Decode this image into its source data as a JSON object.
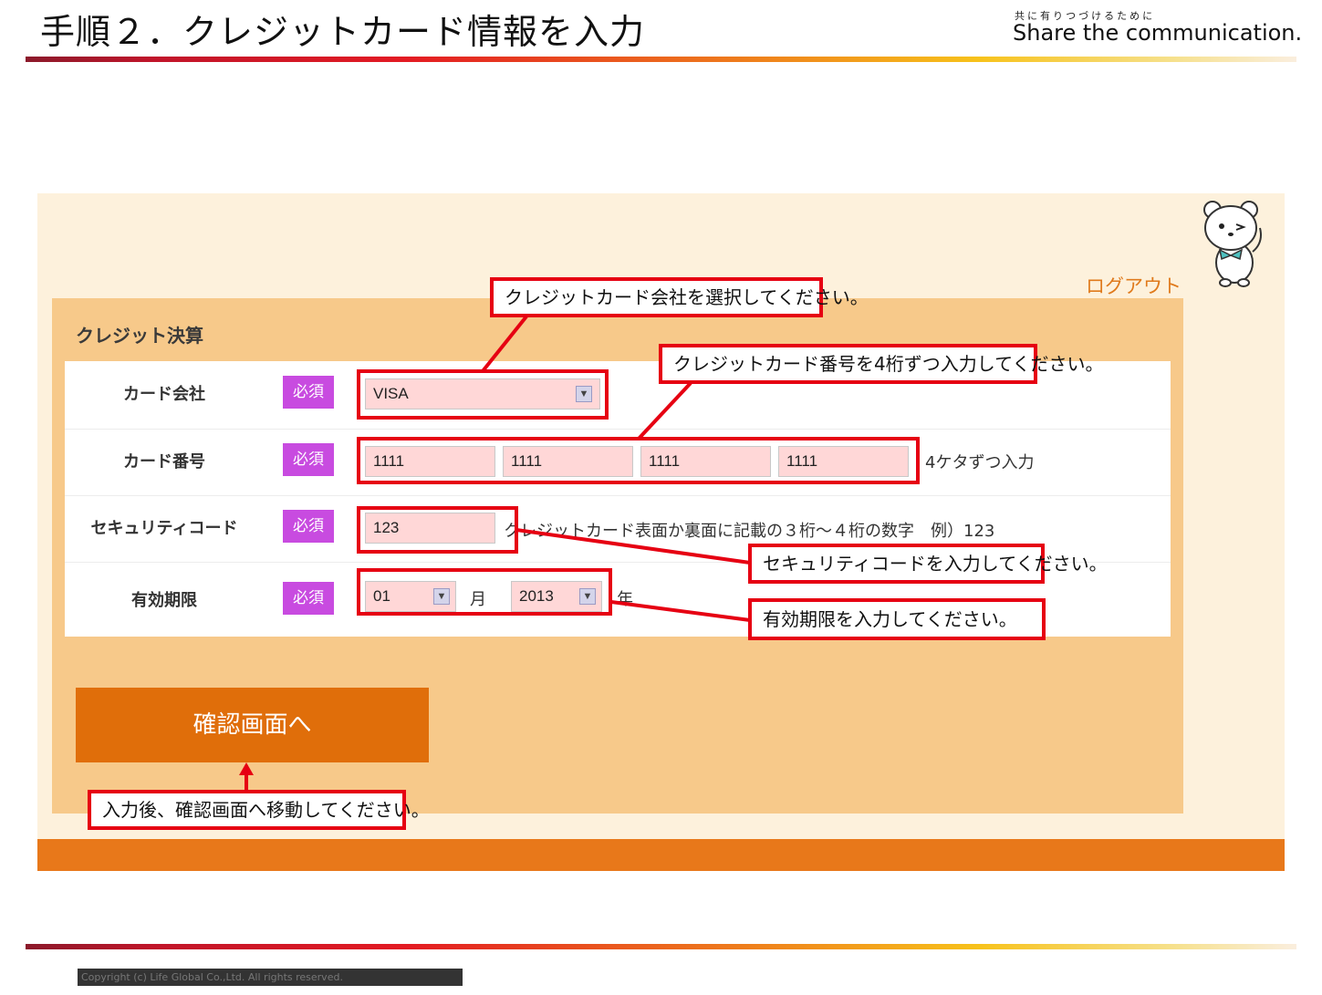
{
  "slide": {
    "title": "手順２．クレジットカード情報を入力",
    "brand_tagline": "共に有りつづけるために",
    "brand_name": "Share the communication."
  },
  "header": {
    "logout_label": "ログアウト"
  },
  "form": {
    "section_title": "クレジット決算",
    "required_label": "必須",
    "card_company": {
      "label": "カード会社",
      "selected": "VISA"
    },
    "card_number": {
      "label": "カード番号",
      "values": [
        "1111",
        "1111",
        "1111",
        "1111"
      ],
      "hint": "4ケタずつ入力"
    },
    "security_code": {
      "label": "セキュリティコード",
      "value": "123",
      "hint": "クレジットカード表面か裏面に記載の３桁～４桁の数字　例）123"
    },
    "expiry": {
      "label": "有効期限",
      "month": "01",
      "month_unit": "月",
      "year": "2013",
      "year_unit": "年"
    },
    "confirm_button": "確認画面へ"
  },
  "callouts": {
    "card_company": "クレジットカード会社を選択してください。",
    "card_number": "クレジットカード番号を4桁ずつ入力してください。",
    "security_code": "セキュリティコードを入力してください。",
    "expiry": "有効期限を入力してください。",
    "confirm": "入力後、確認画面へ移動してください。"
  },
  "footer": {
    "copyright": "Copyright (c) Life Global Co.,Ltd. All rights reserved."
  },
  "colors": {
    "accent_red": "#e60012",
    "orange": "#e8781a",
    "required_purple": "#c84be0",
    "panel_cream": "#fdf1dc",
    "form_orange": "#f7c98a"
  }
}
